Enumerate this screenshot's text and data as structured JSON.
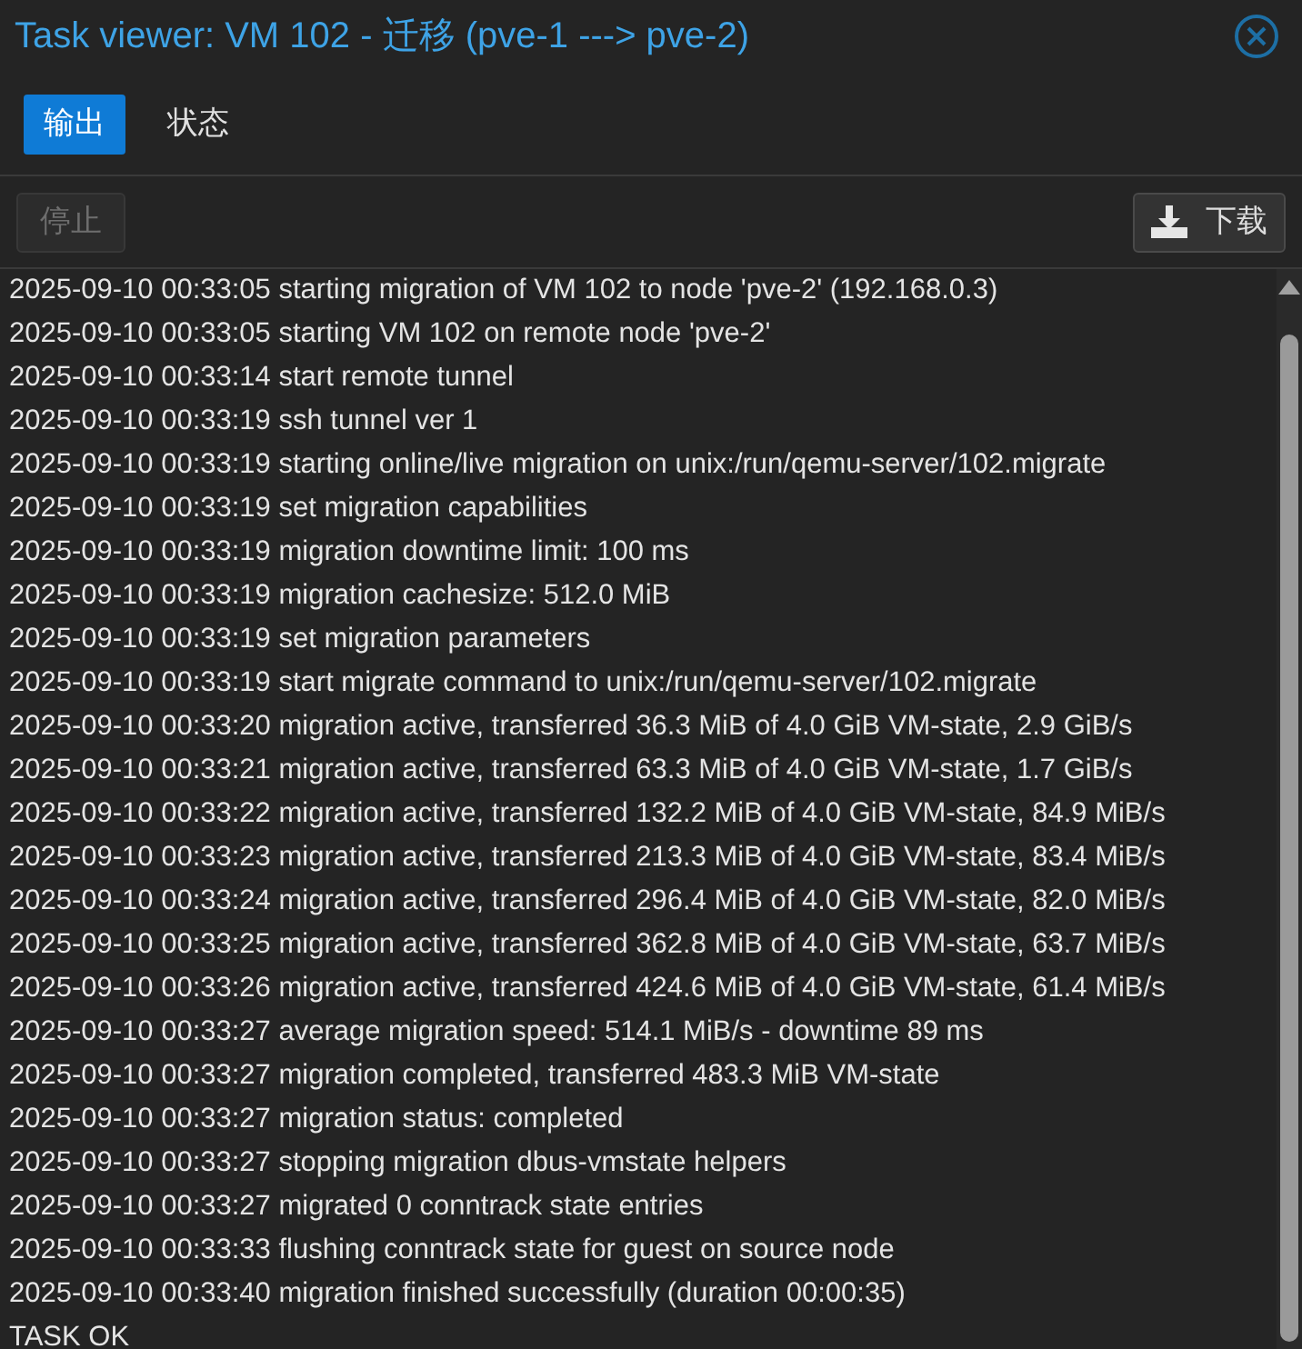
{
  "window": {
    "title": "Task viewer: VM 102 - 迁移 (pve-1 ---> pve-2)"
  },
  "tabs": [
    {
      "label": "输出",
      "selected": true
    },
    {
      "label": "状态",
      "selected": false
    }
  ],
  "toolbar": {
    "stop_button": {
      "label": "停止",
      "disabled": true
    },
    "download_button": {
      "label": "下载"
    }
  },
  "log_lines": [
    "2025-09-10 00:33:05 starting migration of VM 102 to node 'pve-2' (192.168.0.3)",
    "2025-09-10 00:33:05 starting VM 102 on remote node 'pve-2'",
    "2025-09-10 00:33:14 start remote tunnel",
    "2025-09-10 00:33:19 ssh tunnel ver 1",
    "2025-09-10 00:33:19 starting online/live migration on unix:/run/qemu-server/102.migrate",
    "2025-09-10 00:33:19 set migration capabilities",
    "2025-09-10 00:33:19 migration downtime limit: 100 ms",
    "2025-09-10 00:33:19 migration cachesize: 512.0 MiB",
    "2025-09-10 00:33:19 set migration parameters",
    "2025-09-10 00:33:19 start migrate command to unix:/run/qemu-server/102.migrate",
    "2025-09-10 00:33:20 migration active, transferred 36.3 MiB of 4.0 GiB VM-state, 2.9 GiB/s",
    "2025-09-10 00:33:21 migration active, transferred 63.3 MiB of 4.0 GiB VM-state, 1.7 GiB/s",
    "2025-09-10 00:33:22 migration active, transferred 132.2 MiB of 4.0 GiB VM-state, 84.9 MiB/s",
    "2025-09-10 00:33:23 migration active, transferred 213.3 MiB of 4.0 GiB VM-state, 83.4 MiB/s",
    "2025-09-10 00:33:24 migration active, transferred 296.4 MiB of 4.0 GiB VM-state, 82.0 MiB/s",
    "2025-09-10 00:33:25 migration active, transferred 362.8 MiB of 4.0 GiB VM-state, 63.7 MiB/s",
    "2025-09-10 00:33:26 migration active, transferred 424.6 MiB of 4.0 GiB VM-state, 61.4 MiB/s",
    "2025-09-10 00:33:27 average migration speed: 514.1 MiB/s - downtime 89 ms",
    "2025-09-10 00:33:27 migration completed, transferred 483.3 MiB VM-state",
    "2025-09-10 00:33:27 migration status: completed",
    "2025-09-10 00:33:27 stopping migration dbus-vmstate helpers",
    "2025-09-10 00:33:27 migrated 0 conntrack state entries",
    "2025-09-10 00:33:33 flushing conntrack state for guest on source node",
    "2025-09-10 00:33:40 migration finished successfully (duration 00:00:35)",
    "TASK OK"
  ]
}
